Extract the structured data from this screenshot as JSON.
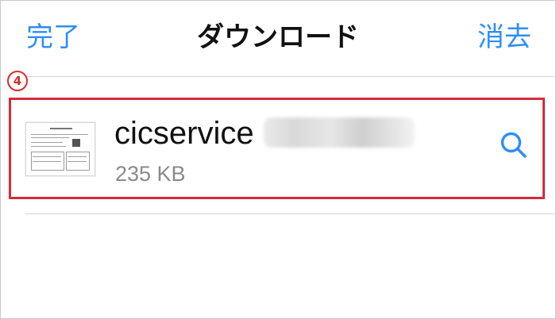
{
  "nav": {
    "left_label": "完了",
    "title": "ダウンロード",
    "right_label": "消去"
  },
  "annotation": {
    "step_number": "4"
  },
  "download": {
    "file_name": "cicservice",
    "file_size": "235 KB",
    "action_icon": "search-icon"
  },
  "colors": {
    "accent": "#2f8ef5",
    "highlight": "#d52b3a"
  }
}
